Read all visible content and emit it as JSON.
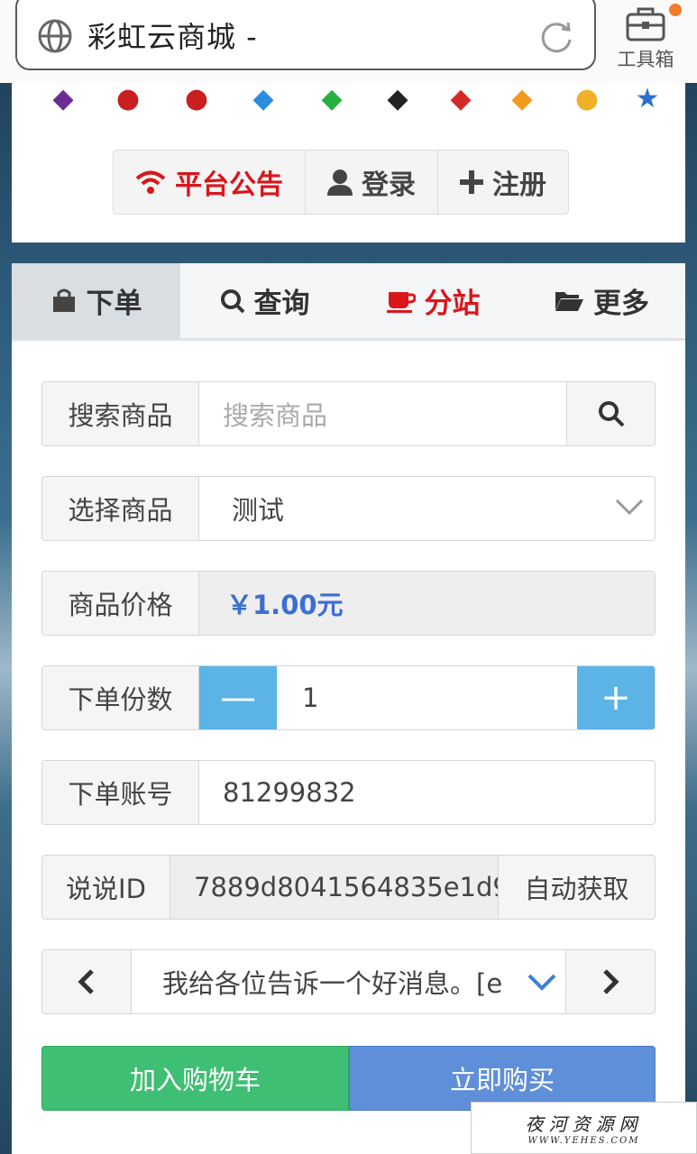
{
  "browser": {
    "url_title": "彩虹云商城 -",
    "toolbox_label": "工具箱"
  },
  "top_card": {
    "icons": [
      "qq-purple-icon",
      "qq-penguin-icon",
      "qq-penguin-red-icon",
      "diamond-blue-icon",
      "diamond-green-icon",
      "diamond-black-icon",
      "diamond-red-icon",
      "diamond-orange-icon",
      "gold-badge-icon",
      "star-blue-icon"
    ],
    "buttons": {
      "notice": "平台公告",
      "login": "登录",
      "register": "注册"
    }
  },
  "tabs": {
    "order": "下单",
    "query": "查询",
    "substation": "分站",
    "more": "更多"
  },
  "form": {
    "search": {
      "label": "搜索商品",
      "placeholder": "搜索商品"
    },
    "select": {
      "label": "选择商品",
      "value": "测试"
    },
    "price": {
      "label": "商品价格",
      "value": "￥1.00元"
    },
    "quantity": {
      "label": "下单份数",
      "value": "1",
      "minus": "—",
      "plus": "+"
    },
    "account": {
      "label": "下单账号",
      "value": "81299832"
    },
    "shuoshuo": {
      "label": "说说ID",
      "value": "7889d8041564835e1d9",
      "auto_button": "自动获取"
    },
    "message": {
      "value": "我给各位告诉一个好消息。[e"
    },
    "add_cart": "加入购物车",
    "buy_now": "立即购买"
  },
  "watermark": {
    "line1": "夜河资源网",
    "line2": "WWW.YEHES.COM"
  },
  "colors": {
    "accent_red": "#d9161c",
    "price_blue": "#3b6fd2",
    "stepper_blue": "#5bb3e6",
    "cart_green": "#3fbf73",
    "buy_blue": "#5f8fd8"
  }
}
